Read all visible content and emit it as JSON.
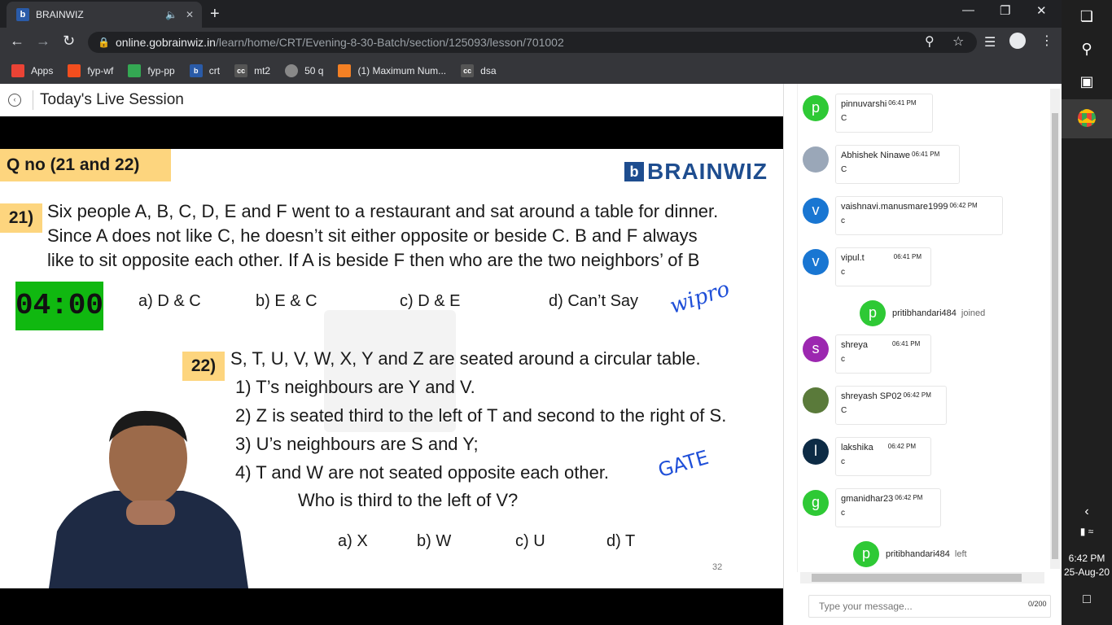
{
  "browser": {
    "tab_title": "BRAINWIZ",
    "url_host": "online.gobrainwiz.in",
    "url_path": "/learn/home/CRT/Evening-8-30-Batch/section/125093/lesson/701002",
    "bookmarks": [
      {
        "label": "Apps",
        "icon": "apps-grid-icon",
        "color": "#ea4335"
      },
      {
        "label": "fyp-wf",
        "icon": "figma-icon",
        "color": "#f24e1e"
      },
      {
        "label": "fyp-pp",
        "icon": "pp-icon",
        "color": "#34a853"
      },
      {
        "label": "crt",
        "icon": "brainwiz-icon",
        "color": "#2a5ba8"
      },
      {
        "label": "mt2",
        "icon": "cc-icon",
        "color": "#555555"
      },
      {
        "label": "50 q",
        "icon": "globe-icon",
        "color": "#888888"
      },
      {
        "label": "(1) Maximum Num...",
        "icon": "stackoverflow-icon",
        "color": "#f48024"
      },
      {
        "label": "dsa",
        "icon": "cc-icon",
        "color": "#555555"
      }
    ]
  },
  "session": {
    "title": "Today's Live Session"
  },
  "slide": {
    "qno": "Q no (21 and 22)",
    "logo_text": "BRAINWIZ",
    "q21_badge": "21)",
    "q21_lines": [
      "Six people A, B, C, D, E and F went to a restaurant and sat around a table for dinner.",
      "Since A does not like C, he doesn’t sit either opposite or beside C. B and F always",
      "like to sit opposite each other. If A is beside F then who are the two neighbors’ of B"
    ],
    "timer": "04:00",
    "q21_options": [
      "a) D & C",
      "b) E & C",
      "c) D & E",
      "d) Can’t Say"
    ],
    "scribble1": "wipro",
    "q22_badge": "22)",
    "q22_lines": [
      "S, T, U, V, W, X, Y and Z are seated around a circular table.",
      "1) T’s neighbours are Y and V.",
      "2) Z is seated third to the left of T and second to the right of S.",
      "3) U’s neighbours are S and Y;",
      "4) T and W are not seated opposite each other.",
      "Who is third to the left of V?"
    ],
    "scribble2": "GATE",
    "q22_options": [
      "a) X",
      "b) W",
      "c) U",
      "d) T"
    ],
    "page_number": "32"
  },
  "chat": {
    "messages": [
      {
        "avatar": "p",
        "color": "#2ec935",
        "name": "pinnuvarshi",
        "time": "06:41 PM",
        "text": "C"
      },
      {
        "avatar": "photo",
        "color": "#9aa7b8",
        "name": "Abhishek Ninawe",
        "time": "06:41 PM",
        "text": "C"
      },
      {
        "avatar": "v",
        "color": "#1976d2",
        "name": "vaishnavi.manusmare1999",
        "time": "06:42 PM",
        "text": "c"
      },
      {
        "avatar": "v",
        "color": "#1976d2",
        "name": "vipul.t",
        "time": "06:41 PM",
        "text": "c"
      },
      {
        "avatar": "s",
        "color": "#9c27b0",
        "name": "shreya",
        "time": "06:41 PM",
        "text": "c"
      },
      {
        "avatar": "photo",
        "color": "#5a7a3a",
        "name": "shreyash SP02",
        "time": "06:42 PM",
        "text": "C"
      },
      {
        "avatar": "l",
        "color": "#0d2b45",
        "name": "lakshika",
        "time": "06:42 PM",
        "text": "c"
      },
      {
        "avatar": "g",
        "color": "#2ec935",
        "name": "gmanidhar23",
        "time": "06:42 PM",
        "text": "c"
      }
    ],
    "event_joined": {
      "avatar": "p",
      "name": "pritibhandari484",
      "action": "joined"
    },
    "event_left": {
      "avatar": "p",
      "name": "pritibhandari484",
      "action": "left"
    },
    "input_placeholder": "Type your message...",
    "counter": "0/200"
  },
  "taskbar": {
    "time": "6:42 PM",
    "date": "25-Aug-20"
  }
}
